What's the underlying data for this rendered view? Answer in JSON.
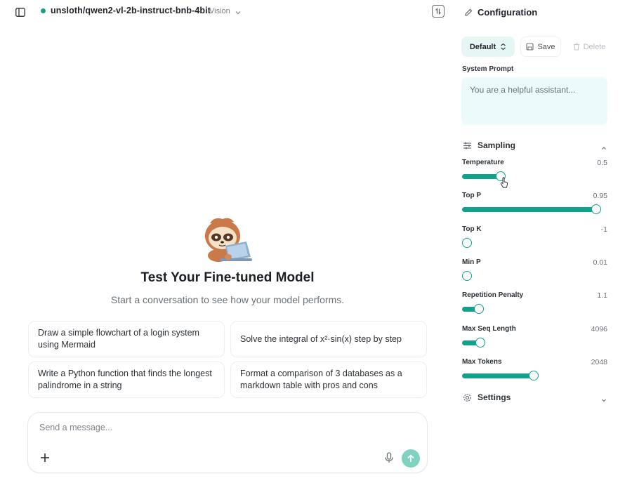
{
  "header": {
    "model_name": "unsloth/qwen2-vl-2b-instruct-bnb-4bit",
    "model_tag": "Vision"
  },
  "hero": {
    "title": "Test Your Fine-tuned Model",
    "subtitle": "Start a conversation to see how your model performs."
  },
  "suggestions": [
    "Draw a simple flowchart of a login system using Mermaid",
    "Solve the integral of x²·sin(x) step by step",
    "Write a Python function that finds the longest palindrome in a string",
    "Format a comparison of 3 databases as a markdown table with pros and cons"
  ],
  "composer": {
    "placeholder": "Send a message..."
  },
  "config": {
    "title": "Configuration",
    "preset_label": "Default",
    "save_label": "Save",
    "delete_label": "Delete",
    "system_prompt_label": "System Prompt",
    "system_prompt_placeholder": "You are a helpful assistant...",
    "sampling_title": "Sampling",
    "settings_title": "Settings",
    "params": [
      {
        "label": "Temperature",
        "value": "0.5",
        "fill": 0.28
      },
      {
        "label": "Top P",
        "value": "0.95",
        "fill": 0.97
      },
      {
        "label": "Top K",
        "value": "-1",
        "fill": 0.0
      },
      {
        "label": "Min P",
        "value": "0.01",
        "fill": 0.02
      },
      {
        "label": "Repetition Penalty",
        "value": "1.1",
        "fill": 0.12
      },
      {
        "label": "Max Seq Length",
        "value": "4096",
        "fill": 0.13
      },
      {
        "label": "Max Tokens",
        "value": "2048",
        "fill": 0.52
      }
    ]
  },
  "colors": {
    "accent": "#12a18a",
    "send_button": "#7fd1c0",
    "preset_bg": "#e6f6f5",
    "system_prompt_bg": "#ecfafb"
  }
}
